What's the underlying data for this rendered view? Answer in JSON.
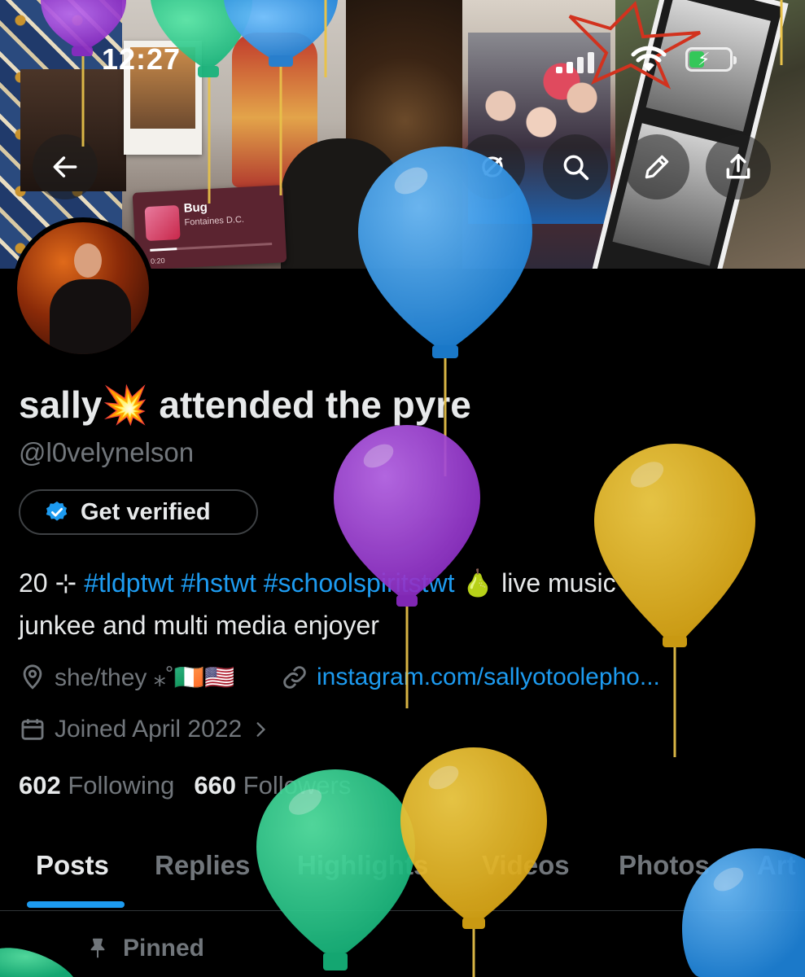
{
  "status_bar": {
    "time": "12:27"
  },
  "header": {
    "music_widget": {
      "song": "Bug",
      "artist": "Fontaines D.C.",
      "elapsed": "0:20",
      "progress": 0.22
    }
  },
  "profile": {
    "display_name": "sally",
    "display_name_emoji": "💥",
    "display_name_rest": "attended the pyre",
    "handle": "@l0velynelson",
    "get_verified_label": "Get verified",
    "bio": {
      "prefix": "20 ⊹ ",
      "hashtags": [
        "#tldptwt",
        "#hstwt",
        "#schoolspiritstwt"
      ],
      "emoji": "🍐",
      "line1_rest": " live music",
      "line2": "junkee and multi media enjoyer"
    },
    "pronouns": "she/they ⁎˚🇮🇪🇺🇸",
    "link": "instagram.com/sallyotoolepho...",
    "joined": "Joined April 2022",
    "following_count": "602",
    "following_label": "Following",
    "followers_count": "660",
    "followers_label": "Followers"
  },
  "tabs": [
    {
      "label": "Posts",
      "active": true
    },
    {
      "label": "Replies",
      "active": false
    },
    {
      "label": "Highlights",
      "active": false
    },
    {
      "label": "Videos",
      "active": false
    },
    {
      "label": "Photos",
      "active": false
    },
    {
      "label": "Art",
      "active": false
    }
  ],
  "pinned_label": "Pinned",
  "colors": {
    "accent": "#1d9bf0",
    "muted": "#71767b",
    "text": "#e7e9ea",
    "background": "#000000"
  }
}
